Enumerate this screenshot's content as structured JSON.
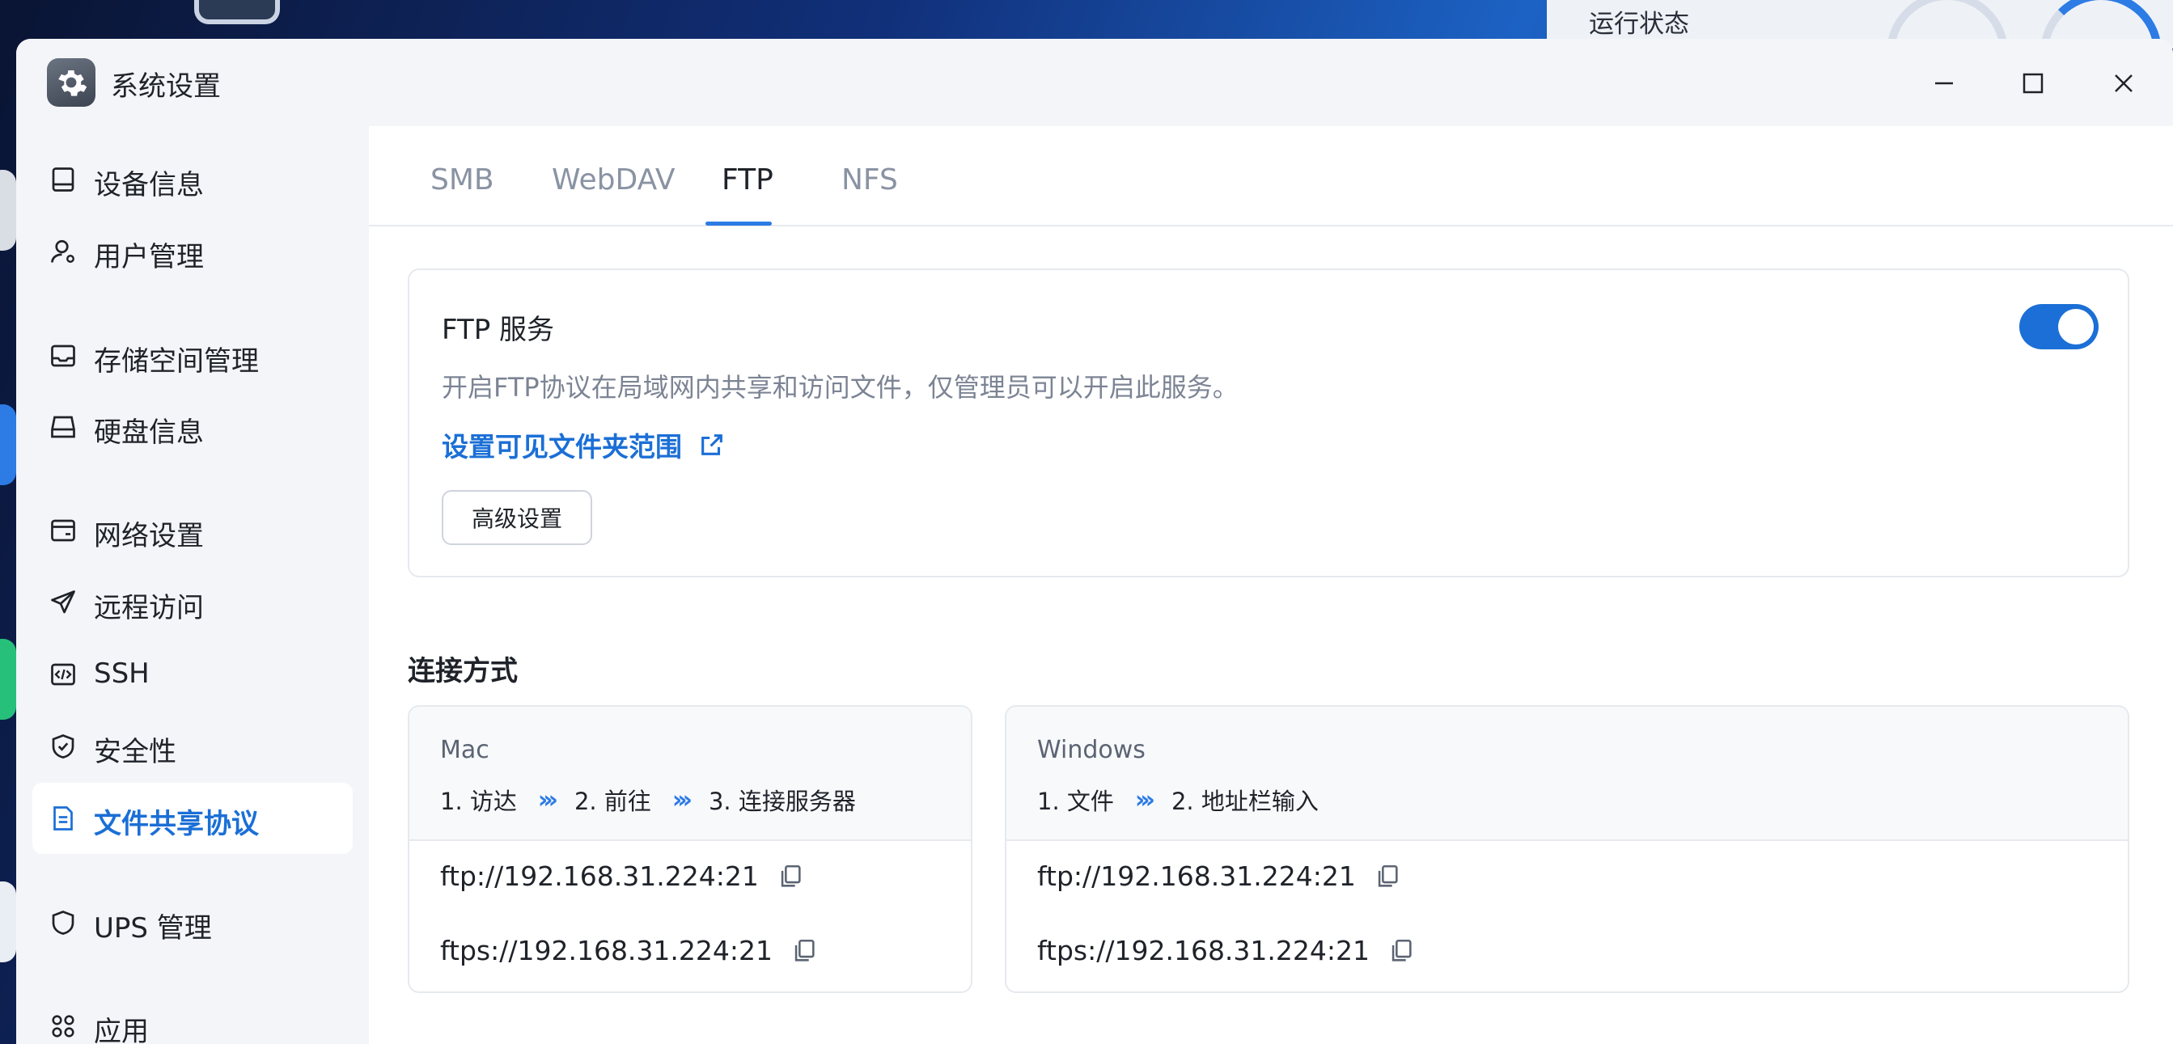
{
  "desktop": {
    "run_status_label": "运行状态"
  },
  "window": {
    "title": "系统设置"
  },
  "sidebar": {
    "items": [
      {
        "label": "设备信息",
        "icon": "device-icon"
      },
      {
        "label": "用户管理",
        "icon": "user-icon"
      },
      {
        "label": "存储空间管理",
        "icon": "storage-icon"
      },
      {
        "label": "硬盘信息",
        "icon": "disk-icon"
      },
      {
        "label": "网络设置",
        "icon": "network-icon"
      },
      {
        "label": "远程访问",
        "icon": "send-icon"
      },
      {
        "label": "SSH",
        "icon": "code-icon"
      },
      {
        "label": "安全性",
        "icon": "shield-check-icon"
      },
      {
        "label": "文件共享协议",
        "icon": "document-icon",
        "active": true
      },
      {
        "label": "UPS 管理",
        "icon": "shield-icon"
      },
      {
        "label": "应用",
        "icon": "apps-grid-icon"
      }
    ]
  },
  "tabs": [
    {
      "label": "SMB"
    },
    {
      "label": "WebDAV"
    },
    {
      "label": "FTP",
      "active": true
    },
    {
      "label": "NFS"
    }
  ],
  "ftp_card": {
    "title": "FTP 服务",
    "description": "开启FTP协议在局域网内共享和访问文件，仅管理员可以开启此服务。",
    "link_label": "设置可见文件夹范围",
    "advanced_button": "高级设置",
    "enabled": true
  },
  "connection": {
    "title": "连接方式",
    "mac": {
      "os": "Mac",
      "steps": [
        "1. 访达",
        "2. 前往",
        "3. 连接服务器"
      ],
      "arrow": "›››",
      "urls": [
        "ftp://192.168.31.224:21",
        "ftps://192.168.31.224:21"
      ]
    },
    "windows": {
      "os": "Windows",
      "steps": [
        "1. 文件",
        "2. 地址栏输入"
      ],
      "arrow": "›››",
      "urls": [
        "ftp://192.168.31.224:21",
        "ftps://192.168.31.224:21"
      ]
    }
  },
  "colors": {
    "accent": "#1b6fd6",
    "sidebar_bg": "#f3f5f8"
  }
}
